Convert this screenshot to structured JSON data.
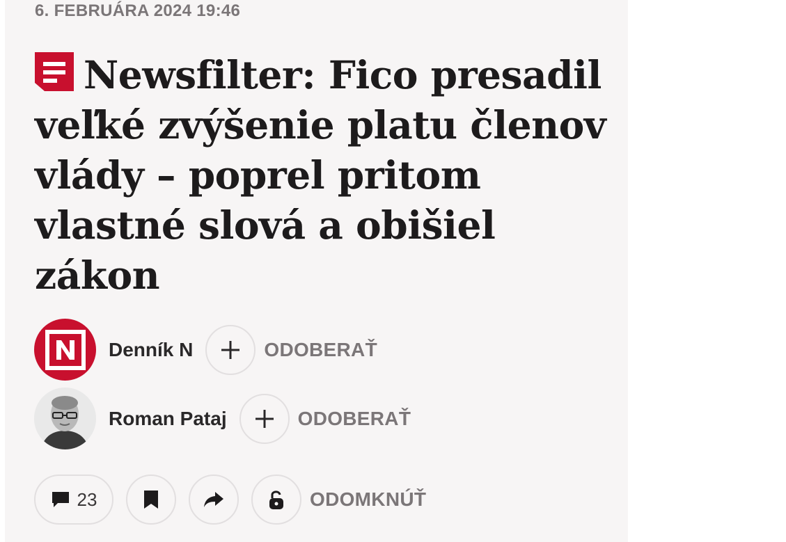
{
  "article": {
    "date": "6. FEBRUÁRA 2024 19:46",
    "title": "Newsfilter: Fico presadil veľké zvýšenie platu členov vlády – poprel pritom vlastné slová a obišiel zákon",
    "title_icon": "newsfilter-document-icon"
  },
  "authors": [
    {
      "name": "Denník N",
      "avatar": "dennik-n-logo",
      "subscribe_label": "ODOBERAŤ"
    },
    {
      "name": "Roman Pataj",
      "avatar": "author-photo",
      "subscribe_label": "ODOBERAŤ"
    }
  ],
  "actions": {
    "comments_count": "23",
    "unlock_label": "ODOMKNÚŤ"
  },
  "colors": {
    "brand_red": "#c8102e",
    "text_dark": "#1d1b1c",
    "text_muted": "#7b7678",
    "card_bg": "#f7f5f5"
  }
}
